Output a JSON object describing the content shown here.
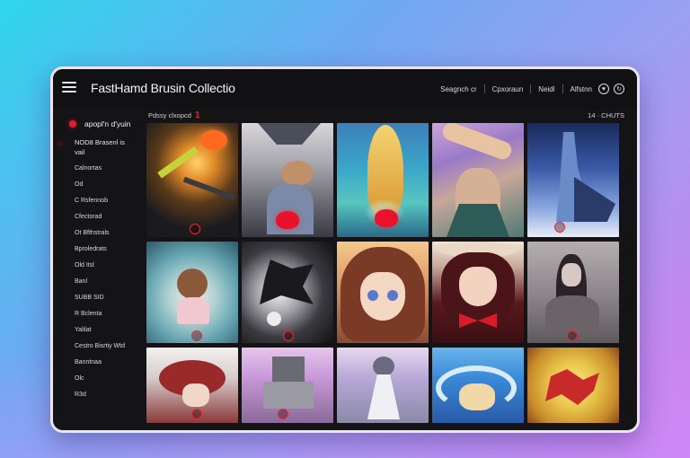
{
  "app": {
    "title": "FastHamd Brusin Collectio"
  },
  "header": {
    "nav": [
      {
        "label": "Seagnch cr"
      },
      {
        "label": "Cpxoraun"
      },
      {
        "label": "Neidl"
      },
      {
        "label": "Alfstnn"
      }
    ],
    "icons": [
      "favorite-icon",
      "share-icon"
    ]
  },
  "sidebar": {
    "active_label": "apopl'n d'yuin",
    "section_label": "NOD8 Brasenl is\nvail",
    "items": [
      "Calnortas",
      "Od",
      "C Rsfennob",
      "Cfectorad",
      "Ot Bfthstrals",
      "Bproledrats",
      "Old Itsl",
      "Banl",
      "SUBB SID",
      "R Bclenta",
      "Yalilat",
      "Cestro Bisrtiy Wtd",
      "Banntnaa",
      "Olc",
      "R3d"
    ],
    "colors": {
      "active_dot": "#e01b2a"
    }
  },
  "main": {
    "toolbar_label": "Pdssy clxopcd",
    "toolbar_mark": "1",
    "count_label": "14 · CHUTS",
    "tiles": [
      {
        "name": "tile-explosion-fire"
      },
      {
        "name": "tile-girl-heart-bowl"
      },
      {
        "name": "tile-golden-hair-glow"
      },
      {
        "name": "tile-purple-figure"
      },
      {
        "name": "tile-blue-statue"
      },
      {
        "name": "tile-teal-swirl-girl"
      },
      {
        "name": "tile-black-white-splash"
      },
      {
        "name": "tile-anime-girl-brown-hair"
      },
      {
        "name": "tile-anime-girl-laughing"
      },
      {
        "name": "tile-long-hair-sketch"
      },
      {
        "name": "tile-red-hair-sketch"
      },
      {
        "name": "tile-pink-robot"
      },
      {
        "name": "tile-pastel-figure"
      },
      {
        "name": "tile-blue-wave-figure"
      },
      {
        "name": "tile-yellow-red-splash"
      }
    ]
  }
}
